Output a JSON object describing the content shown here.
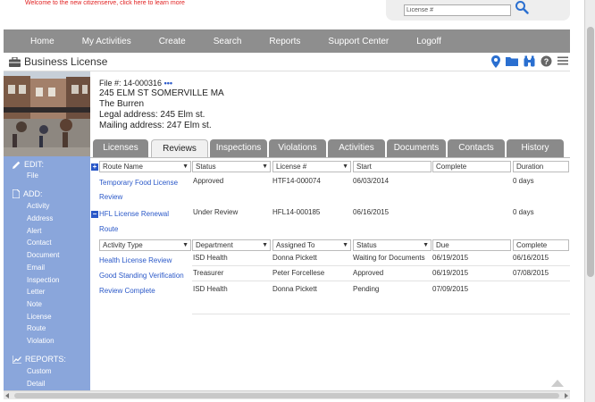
{
  "header": {
    "welcome_text": "Welcome to the new citizenserve, click here to learn more",
    "search_placeholder": "License #"
  },
  "nav": {
    "items": [
      "Home",
      "My Activities",
      "Create",
      "Search",
      "Reports",
      "Support Center",
      "Logoff"
    ]
  },
  "page": {
    "title": "Business License"
  },
  "file": {
    "number": "File #: 14-000316",
    "ellipsis": "•••",
    "address": "245 ELM ST SOMERVILLE MA",
    "name": "The Burren",
    "legal_address": "Legal address: 245 Elm st.",
    "mailing_address": "Mailing address: 247 Elm st."
  },
  "sidebar": {
    "edit_label": "EDIT:",
    "edit_items": [
      "File"
    ],
    "add_label": "ADD:",
    "add_items": [
      "Activity",
      "Address",
      "Alert",
      "Contact",
      "Document",
      "Email",
      "Inspection",
      "Letter",
      "Note",
      "License",
      "Route",
      "Violation"
    ],
    "reports_label": "REPORTS:",
    "report_items": [
      "Custom",
      "Detail"
    ]
  },
  "tabs": {
    "items": [
      "Licenses",
      "Reviews",
      "Inspections",
      "Violations",
      "Activities",
      "Documents",
      "Contacts",
      "History"
    ],
    "active": "Reviews"
  },
  "routes_table": {
    "headers": [
      "Route Name",
      "Status",
      "License #",
      "Start",
      "Complete",
      "Duration"
    ],
    "rows": [
      {
        "name_line1": "Temporary Food License",
        "name_line2": "Review",
        "status": "Approved",
        "license": "HTF14-000074",
        "start": "06/03/2014",
        "complete": "",
        "duration": "0 days",
        "toggle": "+"
      },
      {
        "name_line1": "HFL License Renewal",
        "name_line2": "Route",
        "status": "Under Review",
        "license": "HFL14-000185",
        "start": "06/16/2015",
        "complete": "",
        "duration": "0 days",
        "toggle": "−"
      }
    ]
  },
  "activities_table": {
    "headers": [
      "Activity Type",
      "Department",
      "Assigned To",
      "Status",
      "Due",
      "Complete"
    ],
    "rows": [
      {
        "type": "Health License Review",
        "department": "ISD Health",
        "assigned": "Donna Pickett",
        "status": "Waiting for Documents",
        "due": "06/19/2015",
        "complete": "06/16/2015"
      },
      {
        "type": "Good Standing Verification",
        "department": "Treasurer",
        "assigned": "Peter Forcellese",
        "status": "Approved",
        "due": "06/19/2015",
        "complete": "07/08/2015"
      },
      {
        "type": "Review Complete",
        "department": "ISD Health",
        "assigned": "Donna Pickett",
        "status": "Pending",
        "due": "07/09/2015",
        "complete": ""
      }
    ]
  },
  "colors": {
    "nav_bg": "#8e8e8e",
    "sidebar_bg": "#8aa6db",
    "link": "#2a58c8",
    "welcome": "#e02020"
  }
}
